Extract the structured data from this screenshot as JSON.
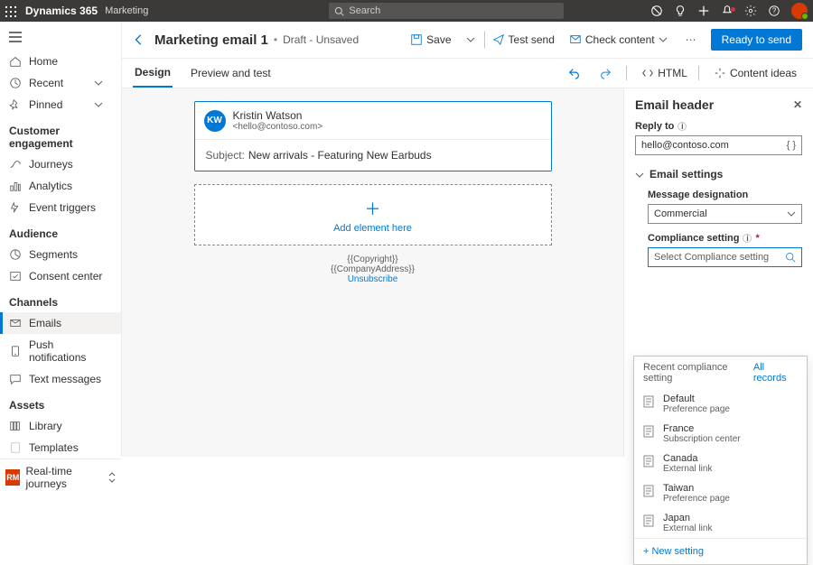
{
  "topbar": {
    "brand": "Dynamics 365",
    "brandsub": "Marketing",
    "search_placeholder": "Search"
  },
  "nav": {
    "home": "Home",
    "recent": "Recent",
    "pinned": "Pinned",
    "sections": {
      "engagement": "Customer engagement",
      "audience": "Audience",
      "channels": "Channels",
      "assets": "Assets"
    },
    "journeys": "Journeys",
    "analytics": "Analytics",
    "event_triggers": "Event triggers",
    "segments": "Segments",
    "consent_center": "Consent center",
    "emails": "Emails",
    "push": "Push notifications",
    "text_msgs": "Text messages",
    "library": "Library",
    "templates": "Templates",
    "footer_badge": "RM",
    "footer_label": "Real-time journeys"
  },
  "page": {
    "title": "Marketing email 1",
    "status": "Draft - Unsaved",
    "save": "Save",
    "test_send": "Test send",
    "check_content": "Check content",
    "ready": "Ready to send"
  },
  "tabs": {
    "design": "Design",
    "preview": "Preview and test",
    "html": "HTML",
    "ideas": "Content ideas"
  },
  "email": {
    "avatar_initials": "KW",
    "from_name": "Kristin Watson",
    "from_addr": "<hello@contoso.com>",
    "subject_label": "Subject:",
    "subject_value": "New arrivals - Featuring New Earbuds",
    "add_element": "Add element here",
    "copyright": "{{Copyright}}",
    "company_address": "{{CompanyAddress}}",
    "unsubscribe": "Unsubscribe"
  },
  "panel": {
    "title": "Email header",
    "reply_to_label": "Reply to",
    "reply_to_value": "hello@contoso.com",
    "email_settings": "Email settings",
    "msg_designation_label": "Message designation",
    "msg_designation_value": "Commercial",
    "compliance_label": "Compliance setting",
    "compliance_value": "Select Compliance setting"
  },
  "dropdown": {
    "recent_label": "Recent compliance setting",
    "all_records": "All records",
    "options": [
      {
        "primary": "Default",
        "secondary": "Preference page"
      },
      {
        "primary": "France",
        "secondary": "Subscription center"
      },
      {
        "primary": "Canada",
        "secondary": "External link"
      },
      {
        "primary": "Taiwan",
        "secondary": "Preference page"
      },
      {
        "primary": "Japan",
        "secondary": "External link"
      }
    ],
    "new_setting": "+ New setting"
  }
}
